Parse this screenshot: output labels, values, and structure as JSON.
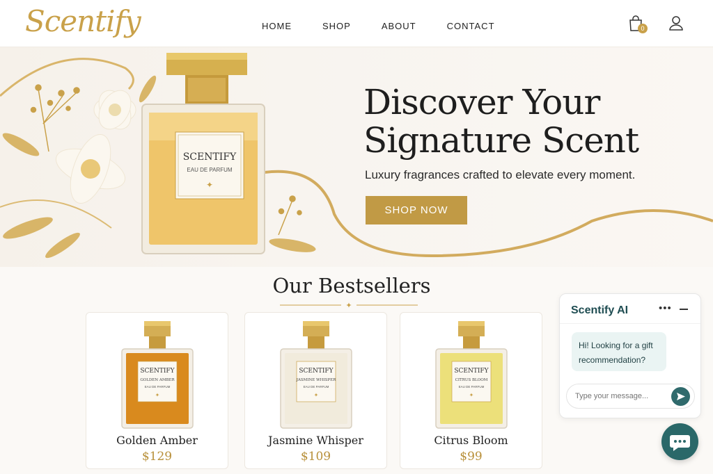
{
  "header": {
    "logo": "Scentify",
    "nav": [
      "HOME",
      "SHOP",
      "ABOUT",
      "CONTACT"
    ],
    "cart_count": "0",
    "icons": {
      "cart": "shopping-bag-icon",
      "user": "user-icon"
    }
  },
  "hero": {
    "title_line1": "Discover Your",
    "title_line2": "Signature Scent",
    "subtitle": "Luxury fragrances crafted to elevate every moment.",
    "cta": "SHOP NOW",
    "bottle_brand": "SCENTIFY",
    "bottle_type": "EAU DE PARFUM"
  },
  "bestsellers": {
    "title": "Our Bestsellers",
    "products": [
      {
        "label_brand": "SCENTIFY",
        "label_name": "GOLDEN AMBER",
        "label_type": "EAU DE PARFUM",
        "name": "Golden Amber",
        "price": "$129",
        "liquid": "#d98a1e"
      },
      {
        "label_brand": "SCENTIFY",
        "label_name": "JASMINE WHISPER",
        "label_type": "EAU DE PARFUM",
        "name": "Jasmine Whisper",
        "price": "$109",
        "liquid": "#f1ebdc"
      },
      {
        "label_brand": "SCENTIFY",
        "label_name": "CITRUS BLOOM",
        "label_type": "EAU DE PARFUM",
        "name": "Citrus Bloom",
        "price": "$99",
        "liquid": "#ece07a"
      }
    ]
  },
  "chat": {
    "title": "Scentify AI",
    "more": "•••",
    "message": "Hi! Looking for a gift recommendation?",
    "placeholder": "Type your message...",
    "icons": {
      "send": "send-icon",
      "launcher": "chat-bubble-icon"
    }
  },
  "colors": {
    "gold": "#c19a45",
    "teal": "#2a6869",
    "price": "#b8903a"
  }
}
